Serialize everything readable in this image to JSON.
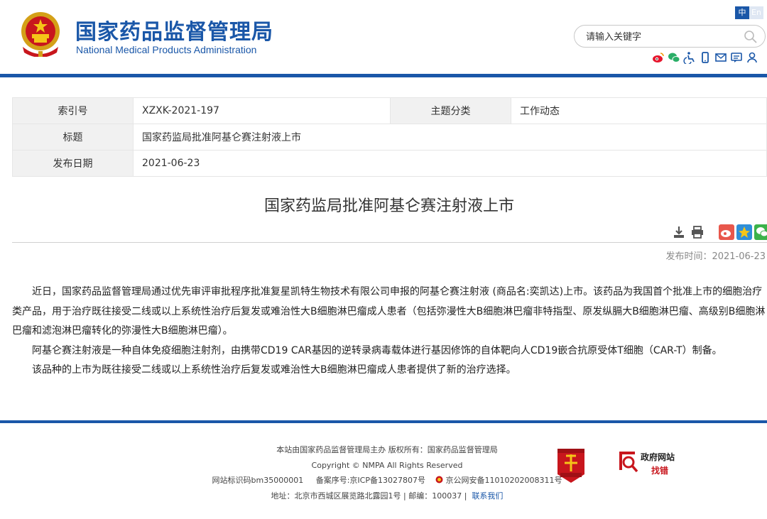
{
  "header": {
    "title_cn": "国家药品监督管理局",
    "title_en": "National Medical Products Administration",
    "lang_zh": "中",
    "lang_en": "En",
    "search_placeholder": "请输入关键字",
    "tool_icons": [
      "weibo-icon",
      "wechat-icon",
      "accessibility-icon",
      "mobile-icon",
      "mail-icon",
      "message-icon",
      "user-icon"
    ],
    "brand_color": "#1a57a8"
  },
  "info_table": {
    "index_label": "索引号",
    "index_value": "XZXK-2021-197",
    "topic_label": "主题分类",
    "topic_value": "工作动态",
    "title_label": "标题",
    "title_value": "国家药监局批准阿基仑赛注射液上市",
    "date_label": "发布日期",
    "date_value": "2021-06-23"
  },
  "article": {
    "title": "国家药监局批准阿基仑赛注射液上市",
    "published": "发布时间：2021-06-23",
    "paragraphs": [
      "近日，国家药品监督管理局通过优先审评审批程序批准复星凯特生物技术有限公司申报的阿基仑赛注射液 (商品名:奕凯达)上市。该药品为我国首个批准上市的细胞治疗类产品，用于治疗既往接受二线或以上系统性治疗后复发或难治性大B细胞淋巴瘤成人患者（包括弥漫性大B细胞淋巴瘤非特指型、原发纵膈大B细胞淋巴瘤、高级别B细胞淋巴瘤和滤泡淋巴瘤转化的弥漫性大B细胞淋巴瘤）。",
      "阿基仑赛注射液是一种自体免疫细胞注射剂，由携带CD19 CAR基因的逆转录病毒载体进行基因修饰的自体靶向人CD19嵌合抗原受体T细胞（CAR-T）制备。",
      "该品种的上市为既往接受二线或以上系统性治疗后复发或难治性大B细胞淋巴瘤成人患者提供了新的治疗选择。"
    ]
  },
  "footer": {
    "line1": "本站由国家药品监督管理局主办 版权所有：国家药品监督管理局",
    "line2": "Copyright © NMPA All Rights Reserved",
    "icp_id": "网站标识码bm35000001",
    "icp_record": "备案序号:京ICP备13027807号",
    "police_record": "京公网安备11010202008311号",
    "address": "地址：北京市西城区展览路北露园1号 | 邮编：100037 |",
    "contact": "联系我们",
    "badge_gov_line1": "政府网站",
    "badge_gov_line2": "找错"
  }
}
